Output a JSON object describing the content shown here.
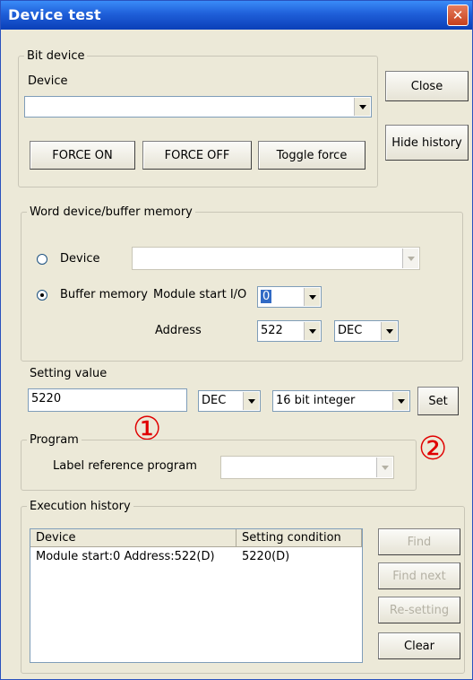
{
  "window": {
    "title": "Device test",
    "close_glyph": "✕"
  },
  "side_buttons": {
    "close": "Close",
    "hide_history": "Hide history"
  },
  "bit_device": {
    "legend": "Bit device",
    "device_label": "Device",
    "device_value": "",
    "buttons": {
      "force_on": "FORCE ON",
      "force_off": "FORCE OFF",
      "toggle": "Toggle force"
    }
  },
  "word_device": {
    "legend": "Word device/buffer memory",
    "radio_device_label": "Device",
    "radio_device_selected": false,
    "radio_buffer_label": "Buffer memory",
    "radio_buffer_selected": true,
    "module_start_label": "Module start I/O",
    "module_start_value": "0",
    "address_label": "Address",
    "address_value": "522",
    "address_format": "DEC"
  },
  "setting": {
    "label": "Setting value",
    "value": "5220",
    "format": "DEC",
    "type": "16 bit integer",
    "set_button": "Set"
  },
  "program": {
    "legend": "Program",
    "label": "Label reference program",
    "value": ""
  },
  "history": {
    "legend": "Execution history",
    "columns": [
      "Device",
      "Setting condition"
    ],
    "rows": [
      {
        "device": "Module start:0 Address:522(D)",
        "condition": "5220(D)"
      }
    ],
    "buttons": {
      "find": "Find",
      "find_next": "Find next",
      "resetting": "Re-setting",
      "clear": "Clear"
    }
  },
  "annotations": {
    "one": "①",
    "two": "②"
  },
  "colors": {
    "title_bar": "#1f5fd9",
    "dialog_bg": "#ece9d8",
    "annotation": "#e00000"
  }
}
